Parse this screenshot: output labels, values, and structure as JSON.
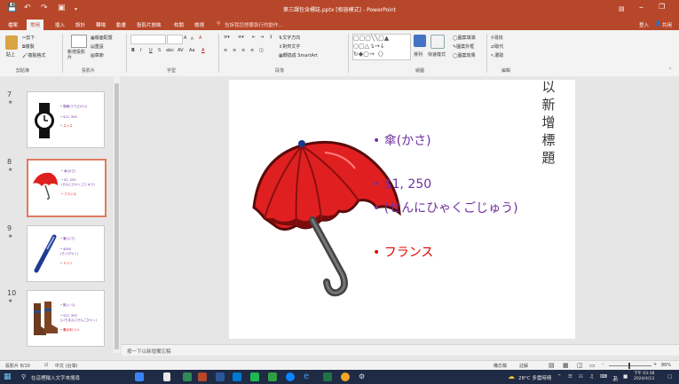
{
  "window": {
    "title": "第三課包含標誌.pptx [相容模式] - PowerPoint",
    "account": "登入",
    "share": "共用"
  },
  "tabs": [
    "檔案",
    "常用",
    "插入",
    "設計",
    "轉場",
    "動畫",
    "投影片放映",
    "校閱",
    "檢視"
  ],
  "active_tab_index": 1,
  "tell_me": "告訴我您想要執行的動作...",
  "ribbon": {
    "clipboard": {
      "paste": "貼上",
      "cut": "剪下",
      "copy": "複製",
      "format_painter": "複製格式",
      "label": "剪貼簿"
    },
    "slides": {
      "new_slide": "新增投影片",
      "layout": "版面配置",
      "reset": "重設",
      "section": "章節",
      "label": "投影片"
    },
    "font": {
      "bold": "B",
      "italic": "I",
      "underline": "U",
      "strike": "S",
      "shadow": "abc",
      "spacing": "AV",
      "case": "Aa",
      "color": "A",
      "grow": "A",
      "shrink": "A",
      "clear": "A",
      "label": "字型"
    },
    "paragraph": {
      "text_direction": "文字方向",
      "align_text": "對齊文字",
      "smartart": "轉換成 SmartArt",
      "label": "段落"
    },
    "drawing": {
      "arrange": "排列",
      "quick_styles": "快速樣式",
      "shape_fill": "圖案填滿",
      "shape_outline": "圖案外框",
      "shape_effects": "圖案效果",
      "label": "繪圖"
    },
    "editing": {
      "find": "尋找",
      "replace": "取代",
      "select": "選取",
      "label": "編輯"
    }
  },
  "thumbnails": [
    {
      "num": "7",
      "lines": [
        "• 腕錶(うでどけい)",
        "• $12, 500",
        "• スイス"
      ],
      "colors": [
        "#7030a0",
        "#7030a0",
        "#e60000"
      ]
    },
    {
      "num": "8",
      "lines": [
        "• 傘(かさ)",
        "• $1, 250",
        "(せんにひゃくごじゅう)",
        "• フランス"
      ],
      "colors": [
        "#7030a0",
        "#7030a0",
        "#7030a0",
        "#e60000"
      ]
    },
    {
      "num": "9",
      "lines": [
        "• 筆(ふで)",
        "• $600",
        "(ろっぴゃく)",
        "• ドイツ"
      ],
      "colors": [
        "#7030a0",
        "#7030a0",
        "#7030a0",
        "#e60000"
      ]
    },
    {
      "num": "10",
      "lines": [
        "• 靴(くつ)",
        "• $12, 500",
        "(いちまんにせんごひゃく)",
        "• 義大利 ジン"
      ],
      "colors": [
        "#7030a0",
        "#7030a0",
        "#7030a0",
        "#e60000"
      ]
    }
  ],
  "selected_thumbnail": 1,
  "slide": {
    "vertical_title": "以新增標題",
    "bullets": [
      {
        "text": "• 傘(かさ)",
        "color": "#7030a0"
      },
      {
        "text": "• $1, 250",
        "color": "#7030a0"
      },
      {
        "text": "• (せんにひゃくごじゅう)",
        "color": "#7030a0"
      },
      {
        "text": "• フランス",
        "color": "#e60000"
      }
    ],
    "colors": {
      "umbrella_red": "#e02020",
      "umbrella_dark": "#7a0c0c",
      "handle": "#555555"
    }
  },
  "notes_placeholder": "按一下以新增備忘稿",
  "status": {
    "slide_of": "投影片 8/10",
    "language": "中文 (台灣)",
    "notes": "備忘稿",
    "comments": "註解",
    "zoom": "86%"
  },
  "taskbar": {
    "search": "在這裡輸入文字來搜尋",
    "weather": "28°C 多雲時晴",
    "ime": "あ",
    "time": "下午 03:38",
    "date": "2024/4/13"
  },
  "accent_color": "#b7472a"
}
